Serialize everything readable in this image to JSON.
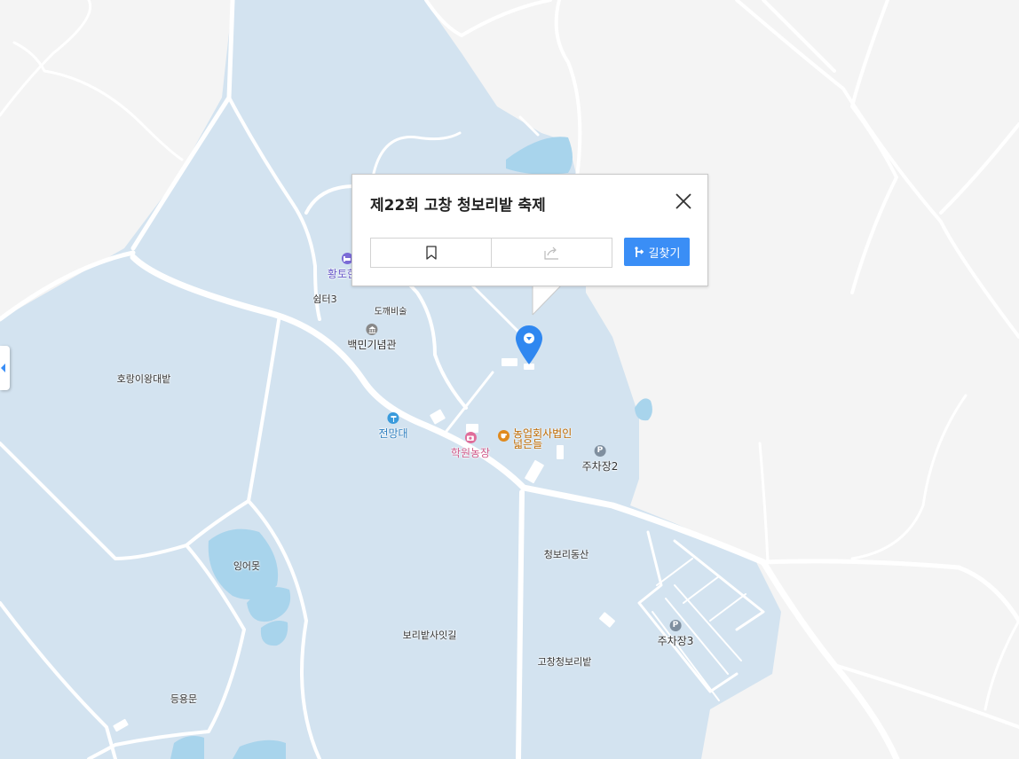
{
  "popup": {
    "title": "제22회 고창 청보리밭 축제",
    "route_label": "길찾기",
    "icons": [
      "bookmark-icon",
      "share-icon",
      "close-icon",
      "route-icon"
    ]
  },
  "map": {
    "colors": {
      "land": "#f4f4f4",
      "park": "#d3e3f0",
      "water": "#a8d4ec",
      "road": "#ffffff"
    },
    "labels": {
      "shelter3": "쉼터3",
      "pottery": "도깨비술",
      "baekmin": "백민기념관",
      "horangi": "호랑이왕대밭",
      "observatory": "전망대",
      "hakwon_farm": "학원농장",
      "farm_corp_1": "농업회사법인",
      "farm_corp_2": "넓은들",
      "parking2": "주차장2",
      "cheongbori_hill": "청보리동산",
      "pond": "잉어못",
      "barley_path": "보리밭사잇길",
      "gochang_barley": "고창청보리밭",
      "parking3": "주차장3",
      "deungyongmun": "등용문",
      "hwangto": "황토한옥"
    }
  }
}
